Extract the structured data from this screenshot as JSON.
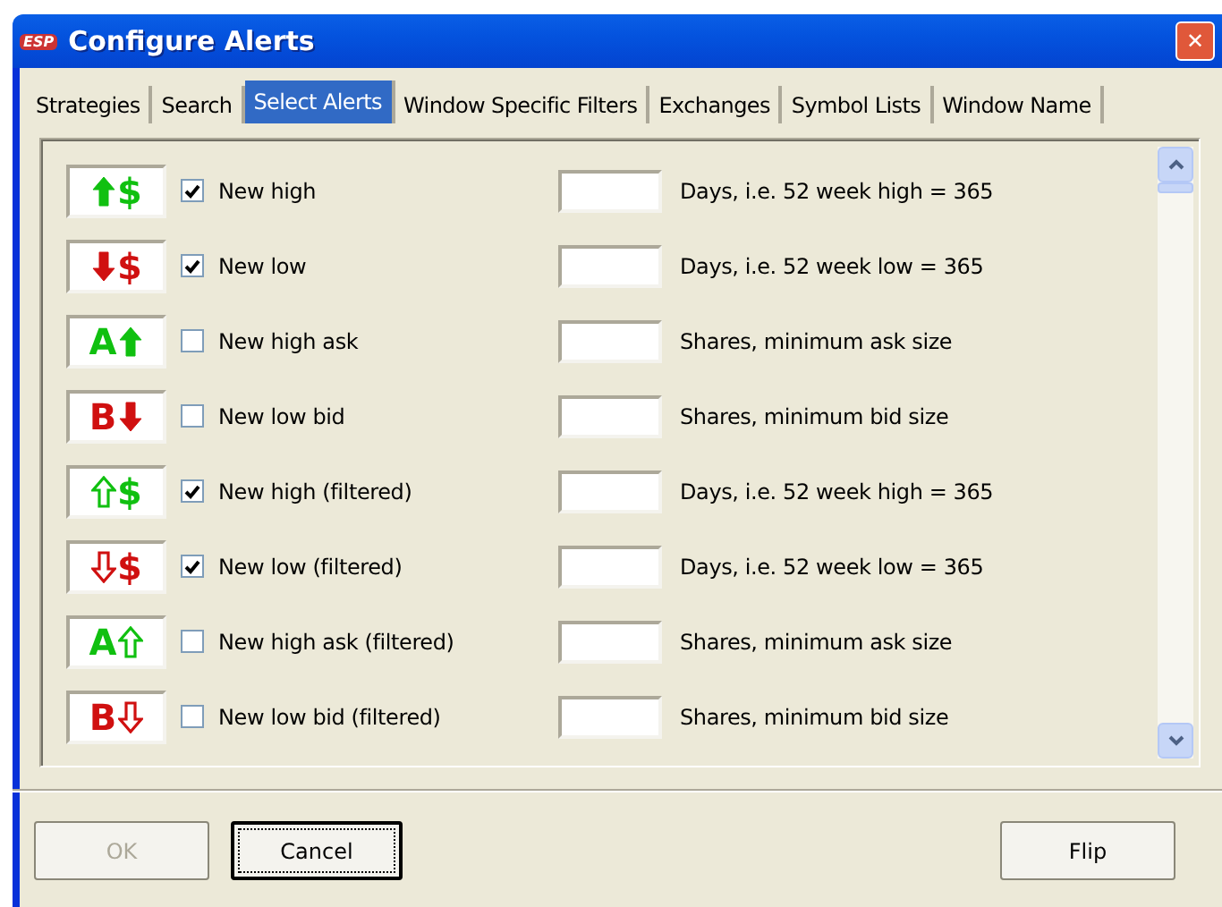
{
  "window": {
    "logo": "ESP",
    "title": "Configure Alerts",
    "close": "✕"
  },
  "tabs": [
    {
      "label": "Strategies",
      "selected": false
    },
    {
      "label": "Search",
      "selected": false
    },
    {
      "label": "Select Alerts",
      "selected": true
    },
    {
      "label": "Window Specific Filters",
      "selected": false
    },
    {
      "label": "Exchanges",
      "selected": false
    },
    {
      "label": "Symbol Lists",
      "selected": false
    },
    {
      "label": "Window Name",
      "selected": false
    }
  ],
  "alerts": [
    {
      "icon": {
        "symbol": "$",
        "kind": "up",
        "outline": false,
        "arrow_first": true,
        "color": "#10c010"
      },
      "label": "New high",
      "checked": true,
      "description": "Days, i.e. 52 week high = 365"
    },
    {
      "icon": {
        "symbol": "$",
        "kind": "down",
        "outline": false,
        "arrow_first": true,
        "color": "#d01010"
      },
      "label": "New low",
      "checked": true,
      "description": "Days, i.e. 52 week low = 365"
    },
    {
      "icon": {
        "symbol": "A",
        "kind": "up",
        "outline": false,
        "arrow_first": false,
        "color": "#10c010"
      },
      "label": "New high ask",
      "checked": false,
      "description": "Shares, minimum ask size"
    },
    {
      "icon": {
        "symbol": "B",
        "kind": "down",
        "outline": false,
        "arrow_first": false,
        "color": "#d01010"
      },
      "label": "New low bid",
      "checked": false,
      "description": "Shares, minimum bid size"
    },
    {
      "icon": {
        "symbol": "$",
        "kind": "up",
        "outline": true,
        "arrow_first": true,
        "color": "#10c010"
      },
      "label": "New high (filtered)",
      "checked": true,
      "description": "Days, i.e. 52 week high = 365"
    },
    {
      "icon": {
        "symbol": "$",
        "kind": "down",
        "outline": true,
        "arrow_first": true,
        "color": "#d01010"
      },
      "label": "New low (filtered)",
      "checked": true,
      "description": "Days, i.e. 52 week low = 365"
    },
    {
      "icon": {
        "symbol": "A",
        "kind": "up",
        "outline": true,
        "arrow_first": false,
        "color": "#10c010"
      },
      "label": "New high ask (filtered)",
      "checked": false,
      "description": "Shares, minimum ask size"
    },
    {
      "icon": {
        "symbol": "B",
        "kind": "down",
        "outline": true,
        "arrow_first": false,
        "color": "#d01010"
      },
      "label": "New low bid (filtered)",
      "checked": false,
      "description": "Shares, minimum bid size"
    }
  ],
  "buttons": [
    {
      "label": "OK",
      "disabled": true,
      "focused": false
    },
    {
      "label": "Cancel",
      "disabled": false,
      "focused": true
    },
    {
      "label": "Flip",
      "disabled": false,
      "focused": false
    }
  ]
}
